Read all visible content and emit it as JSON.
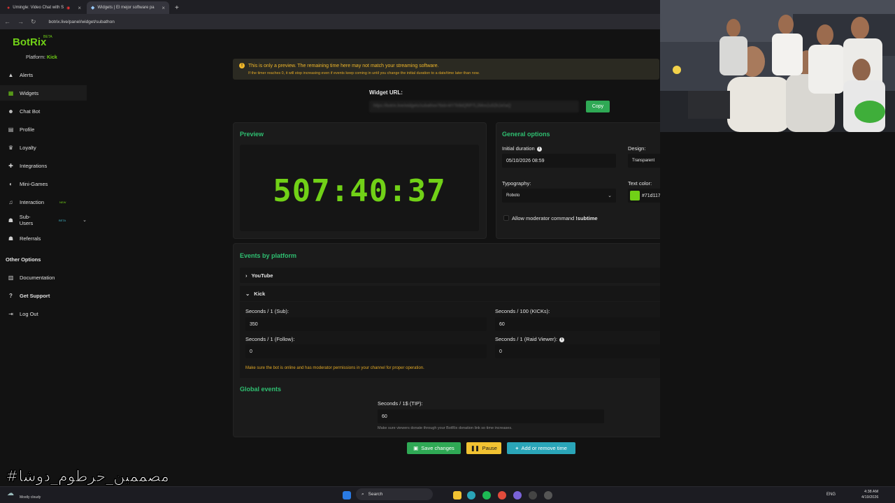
{
  "browser": {
    "tabs": [
      {
        "label": "Umingle: Video Chat with S",
        "active": false
      },
      {
        "label": "Widgets | El mejor software pa",
        "active": true
      }
    ],
    "url": "botrix.live/panel/widget/subathon"
  },
  "brand": {
    "name": "BotRix",
    "badge": "BETA"
  },
  "platform": {
    "label": "Platform:",
    "value": "Kick"
  },
  "sidebar": {
    "items": [
      {
        "label": "Alerts",
        "icon": "warning-icon"
      },
      {
        "label": "Widgets",
        "icon": "grid-icon"
      },
      {
        "label": "Chat Bot",
        "icon": "robot-icon"
      },
      {
        "label": "Profile",
        "icon": "id-card-icon"
      },
      {
        "label": "Loyalty",
        "icon": "trophy-icon"
      },
      {
        "label": "Integrations",
        "icon": "plugin-icon"
      },
      {
        "label": "Mini-Games",
        "icon": "gamepad-icon"
      },
      {
        "label": "Interaction",
        "icon": "music-icon",
        "badge": "NEW"
      },
      {
        "label": "Sub-Users",
        "icon": "users-icon",
        "badge": "BETA"
      },
      {
        "label": "Referrals",
        "icon": "referral-icon"
      }
    ],
    "other_heading": "Other Options",
    "other_items": [
      {
        "label": "Documentation",
        "icon": "book-icon"
      },
      {
        "label": "Get Support",
        "icon": "help-icon"
      },
      {
        "label": "Log Out",
        "icon": "logout-icon"
      }
    ]
  },
  "notice": {
    "line1": "This is only a preview. The remaining time here may not match your streaming software.",
    "line2": "If the timer reaches 0, it will stop increasing even if events keep coming in until you change the initial duration to a date/time later than now."
  },
  "widget_url": {
    "label": "Widget URL:",
    "value": "https://botrix.live/widgets/subathon?bid=i4Y7k9dQRP7L2Mvx2u5Zk1k0aQ",
    "copy_label": "Copy"
  },
  "preview": {
    "title": "Preview",
    "timer": "507:40:37"
  },
  "general": {
    "title": "General options",
    "initial_duration_label": "Initial duration",
    "initial_duration_value": "05/10/2026 08:59",
    "design_label": "Design:",
    "design_value": "Transparent",
    "typography_label": "Typography:",
    "typography_value": "Roboto",
    "text_color_label": "Text color:",
    "text_color_value": "#71d117",
    "allow_mod_label": "Allow moderator command",
    "allow_mod_cmd": "!subtime"
  },
  "events": {
    "title": "Events by platform",
    "youtube_label": "YouTube",
    "kick_label": "Kick",
    "sub_label": "Seconds / 1 (Sub):",
    "sub_value": "350",
    "kicks_label": "Seconds / 100 (KICKs):",
    "kicks_value": "60",
    "follow_label": "Seconds / 1 (Follow):",
    "follow_value": "0",
    "raid_label": "Seconds / 1 (Raid Viewer):",
    "raid_value": "0",
    "kick_hint": "Make sure the bot is online and has moderator permissions in your channel for proper operation."
  },
  "global": {
    "title": "Global events",
    "tip_label": "Seconds / 1$ (TIP):",
    "tip_value": "60",
    "tip_hint": "Make sure viewers donate through your BotRix donation link so time increases."
  },
  "actions": {
    "save": "Save changes",
    "pause": "Pause",
    "add": "Add or remove time"
  },
  "taskbar": {
    "weather": "Mostly cloudy",
    "search": "Search",
    "lang": "ENG",
    "time": "4:38 AM",
    "date": "4/19/2026"
  },
  "overlay_text": "#مصممين_خرطوم_دوشا",
  "colors": {
    "accent": "#71d117",
    "title_green": "#2fbf71",
    "warning": "#f0b72a",
    "save": "#2fa955",
    "pause": "#f1c232",
    "add": "#2aa5b8"
  }
}
